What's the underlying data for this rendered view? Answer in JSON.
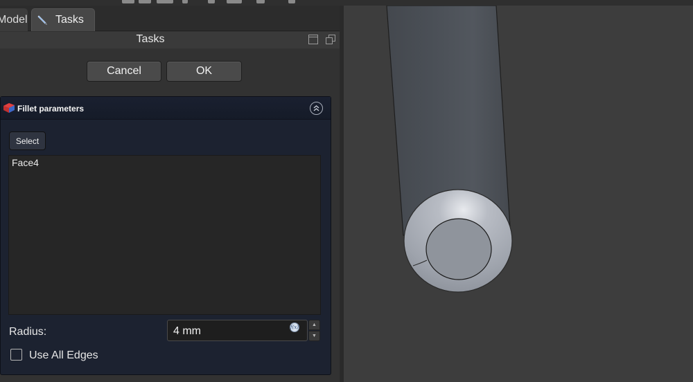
{
  "tabs": [
    {
      "label": "Model"
    },
    {
      "label": "Tasks"
    }
  ],
  "panel": {
    "title": "Tasks",
    "cancel_label": "Cancel",
    "ok_label": "OK"
  },
  "fillet": {
    "title": "Fillet parameters",
    "select_label": "Select",
    "items": [
      "Face4"
    ],
    "radius_label": "Radius:",
    "radius_value": "4 mm",
    "use_all_edges_label": "Use All Edges",
    "use_all_edges_checked": false
  },
  "colors": {
    "panel_bg": "#323232",
    "box_bg": "#1c2230",
    "viewport_bg": "#3d3d3d"
  },
  "icons": [
    "pencil-icon",
    "fillet-part-icon",
    "collapse-chevrons-icon",
    "expression-icon",
    "spin-up-icon",
    "spin-down-icon",
    "float-panel-icon",
    "undock-panel-icon"
  ]
}
